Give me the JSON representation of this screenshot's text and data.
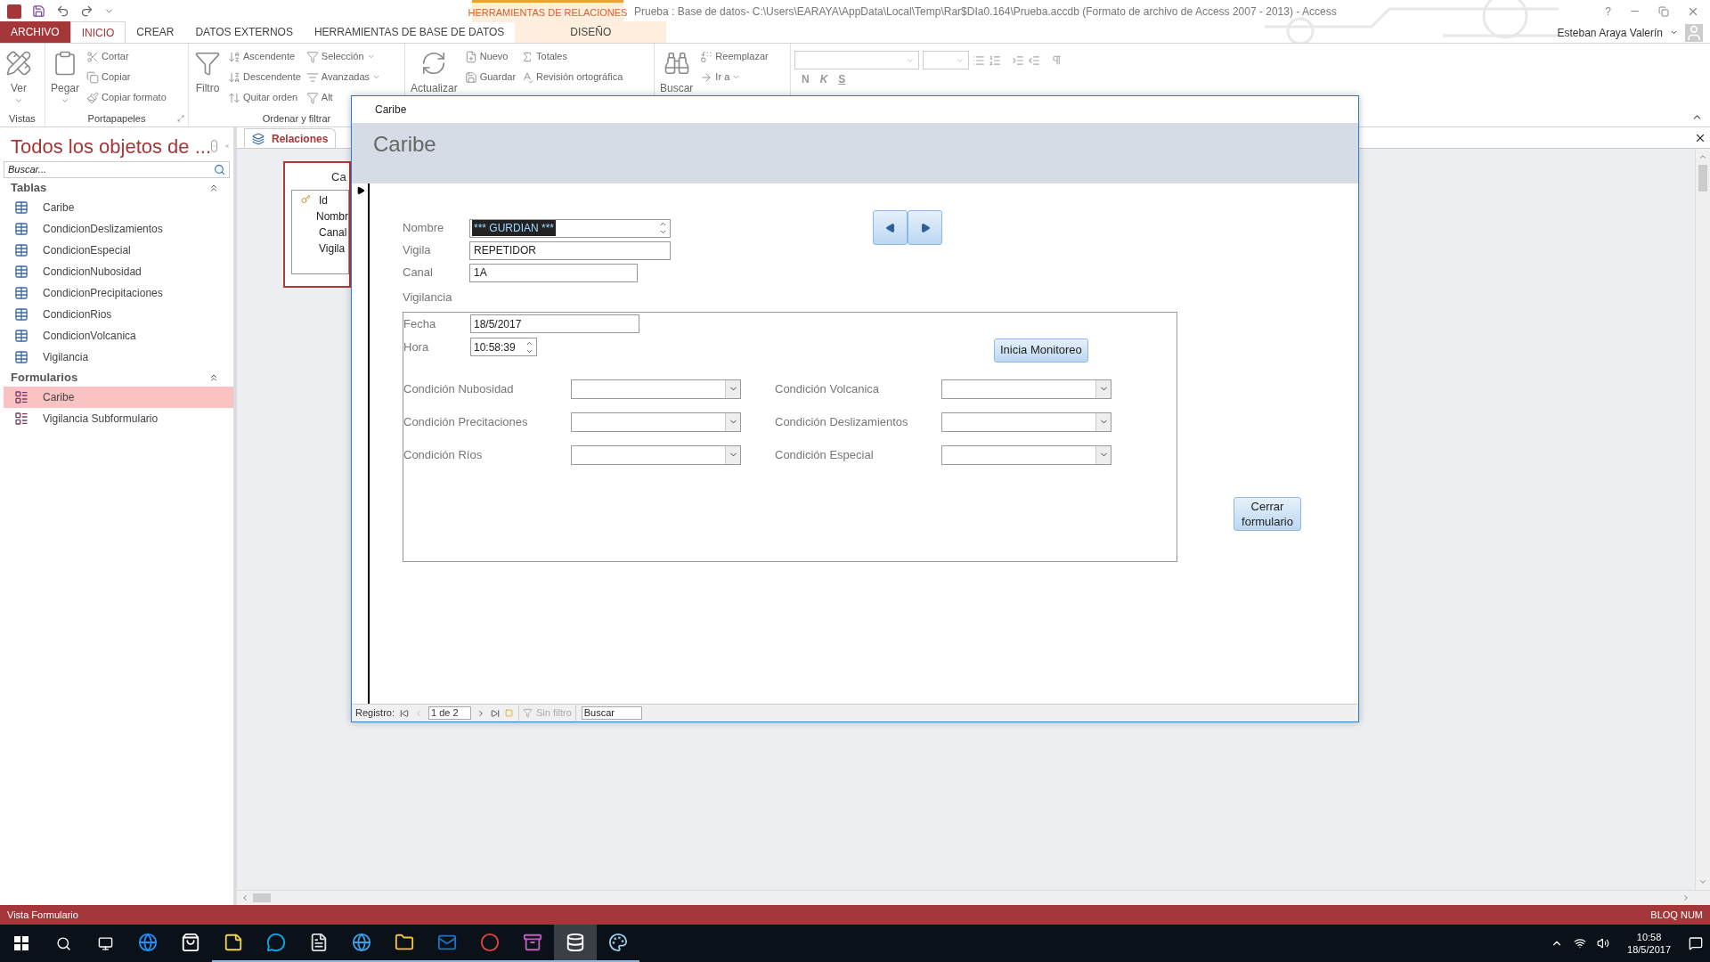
{
  "title_bar": {
    "title": "Prueba : Base de datos- C:\\Users\\EARAYA\\AppData\\Local\\Temp\\Rar$DIa0.164\\Prueba.accdb (Formato de archivo de Access 2007 - 2013) - Access",
    "context_group": "HERRAMIENTAS DE RELACIONES",
    "help": "?",
    "user": "Esteban Araya Valerín"
  },
  "ribbon_tabs": [
    {
      "label": "ARCHIVO",
      "kind": "file",
      "selected": false
    },
    {
      "label": "INICIO",
      "kind": "normal",
      "selected": true
    },
    {
      "label": "CREAR",
      "kind": "normal",
      "selected": false
    },
    {
      "label": "DATOS EXTERNOS",
      "kind": "normal",
      "selected": false
    },
    {
      "label": "HERRAMIENTAS DE BASE DE DATOS",
      "kind": "normal",
      "selected": false
    },
    {
      "label": "DISEÑO",
      "kind": "contextual",
      "selected": false
    }
  ],
  "ribbon_groups": [
    {
      "label": "Vistas",
      "launcher": false,
      "commands": [
        {
          "label": "Ver",
          "kind": "large",
          "menu": true
        }
      ]
    },
    {
      "label": "Portapapeles",
      "launcher": true,
      "commands": [
        {
          "label": "Pegar",
          "kind": "large",
          "menu": true
        },
        {
          "label": "Cortar",
          "kind": "small",
          "menu": false
        },
        {
          "label": "Copiar",
          "kind": "small",
          "menu": false
        },
        {
          "label": "Copiar formato",
          "kind": "small",
          "menu": false
        }
      ]
    },
    {
      "label": "Ordenar y filtrar",
      "launcher": false,
      "commands": [
        {
          "label": "Filtro",
          "kind": "large",
          "menu": false
        },
        {
          "label": "Ascendente",
          "kind": "small",
          "menu": false
        },
        {
          "label": "Descendente",
          "kind": "small",
          "menu": false
        },
        {
          "label": "Quitar orden",
          "kind": "small",
          "menu": false
        },
        {
          "label": "Selección",
          "kind": "small",
          "menu": true
        },
        {
          "label": "Avanzadas",
          "kind": "small",
          "menu": true
        },
        {
          "label": "Alt",
          "kind": "small",
          "menu": false
        }
      ]
    },
    {
      "commands": [
        {
          "label": "Actualizar",
          "kind": "large",
          "menu": false
        },
        {
          "label": "Nuevo",
          "kind": "small",
          "menu": false
        },
        {
          "label": "Guardar",
          "kind": "small",
          "menu": false
        },
        {
          "label": "Totales",
          "kind": "small",
          "menu": false
        },
        {
          "label": "Revisión ortográfica",
          "kind": "small",
          "menu": false
        }
      ]
    },
    {
      "commands": [
        {
          "label": "Buscar",
          "kind": "large",
          "menu": false
        },
        {
          "label": "Reemplazar",
          "kind": "small",
          "menu": false
        },
        {
          "label": "Ir a",
          "kind": "small",
          "menu": true
        }
      ]
    }
  ],
  "text_format": {
    "bold": "N",
    "italic": "K",
    "underline": "S"
  },
  "nav_pane": {
    "title": "Todos los objetos de ...",
    "search": {
      "placeholder": "Buscar..."
    },
    "sections": [
      {
        "label": "Tablas",
        "items": [
          {
            "label": "Caribe",
            "kind": "table",
            "selected": false
          },
          {
            "label": "CondicionDeslizamientos",
            "kind": "table",
            "selected": false
          },
          {
            "label": "CondicionEspecial",
            "kind": "table",
            "selected": false
          },
          {
            "label": "CondicionNubosidad",
            "kind": "table",
            "selected": false
          },
          {
            "label": "CondicionPrecipitaciones",
            "kind": "table",
            "selected": false
          },
          {
            "label": "CondicionRios",
            "kind": "table",
            "selected": false
          },
          {
            "label": "CondicionVolcanica",
            "kind": "table",
            "selected": false
          },
          {
            "label": "Vigilancia",
            "kind": "table",
            "selected": false
          }
        ]
      },
      {
        "label": "Formularios",
        "items": [
          {
            "label": "Caribe",
            "kind": "form",
            "selected": true
          },
          {
            "label": "Vigilancia Subformulario",
            "kind": "form",
            "selected": false
          }
        ]
      }
    ]
  },
  "document_tab": {
    "label": "Relaciones"
  },
  "relationship_table": {
    "title": "Ca",
    "fields": [
      {
        "name": "Id",
        "key": true
      },
      {
        "name": "Nombr",
        "key": false
      },
      {
        "name": "Canal",
        "key": false
      },
      {
        "name": "Vigila",
        "key": false
      }
    ]
  },
  "form_window": {
    "title": "Caribe",
    "header": "Caribe",
    "fields": [
      {
        "label": "Nombre",
        "value": "*** GURDIAN ***",
        "kind": "combo-spin",
        "highlighted": true
      },
      {
        "label": "Vigila",
        "value": "REPETIDOR",
        "kind": "text",
        "highlighted": false
      },
      {
        "label": "Canal",
        "value": "1A",
        "kind": "short",
        "highlighted": false
      }
    ],
    "section_label": "Vigilancia",
    "subform": {
      "fields": [
        {
          "label": "Fecha",
          "value": "18/5/2017",
          "kind": "text"
        },
        {
          "label": "Hora",
          "value": "10:58:39",
          "kind": "spin"
        }
      ],
      "start_button": "Inicia Monitoreo",
      "combos": [
        {
          "label": "Condición Nubosidad"
        },
        {
          "label": "Condición Volcanica"
        },
        {
          "label": "Condición Precitaciones"
        },
        {
          "label": "Condición Deslizamientos"
        },
        {
          "label": "Condición Ríos"
        },
        {
          "label": "Condición Especial"
        }
      ]
    },
    "close_button": "Cerrar formulario",
    "record_nav": {
      "label": "Registro:",
      "position": "1 de 2",
      "filter": {
        "label": "Sin filtro",
        "disabled": true
      },
      "search": {
        "placeholder": "Buscar"
      }
    }
  },
  "status_bar": {
    "left": "Vista Formulario",
    "right": "BLOQ NUM"
  },
  "taskbar": {
    "apps": [
      {
        "kind": "browser",
        "running": false,
        "selected": false
      },
      {
        "kind": "store",
        "running": false,
        "selected": false
      },
      {
        "kind": "notes",
        "running": true,
        "selected": false
      },
      {
        "kind": "chat",
        "running": true,
        "selected": false
      },
      {
        "kind": "document",
        "running": true,
        "selected": false
      },
      {
        "kind": "globe",
        "running": true,
        "selected": false
      },
      {
        "kind": "folder",
        "running": true,
        "selected": false
      },
      {
        "kind": "mail",
        "running": true,
        "selected": false
      },
      {
        "kind": "circle",
        "running": true,
        "selected": false
      },
      {
        "kind": "archive",
        "running": true,
        "selected": false
      },
      {
        "kind": "database",
        "running": true,
        "selected": true
      },
      {
        "kind": "palette",
        "running": true,
        "selected": false
      }
    ],
    "time": "10:58",
    "date": "18/5/2017"
  }
}
